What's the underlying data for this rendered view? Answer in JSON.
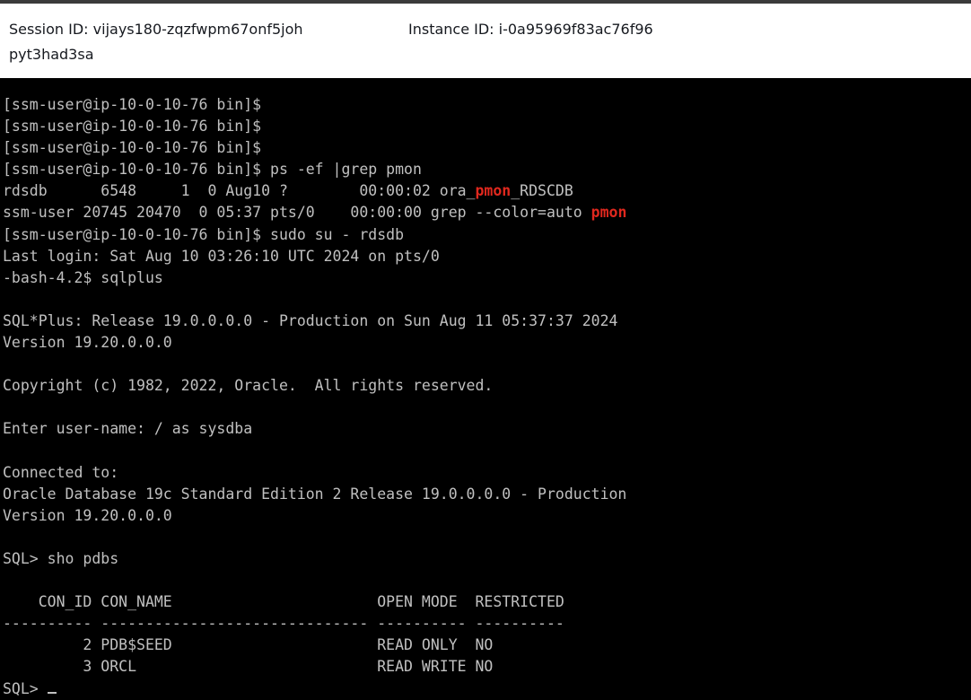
{
  "header": {
    "session_label": "Session ID: vijays180-zqzfwpm67onf5johpyt3had3sa",
    "instance_label": "Instance ID: i-0a95969f83ac76f96"
  },
  "terminal": {
    "lines": [
      "[ssm-user@ip-10-0-10-76 bin]$",
      "[ssm-user@ip-10-0-10-76 bin]$",
      "[ssm-user@ip-10-0-10-76 bin]$",
      "[ssm-user@ip-10-0-10-76 bin]$ ps -ef |grep pmon",
      "rdsdb      6548     1  0 Aug10 ?        00:00:02 ora_pmon_RDSCDB",
      "ssm-user 20745 20470  0 05:37 pts/0    00:00:00 grep --color=auto pmon",
      "[ssm-user@ip-10-0-10-76 bin]$ sudo su - rdsdb",
      "Last login: Sat Aug 10 03:26:10 UTC 2024 on pts/0",
      "-bash-4.2$ sqlplus",
      "",
      "SQL*Plus: Release 19.0.0.0.0 - Production on Sun Aug 11 05:37:37 2024",
      "Version 19.20.0.0.0",
      "",
      "Copyright (c) 1982, 2022, Oracle.  All rights reserved.",
      "",
      "Enter user-name: / as sysdba",
      "",
      "Connected to:",
      "Oracle Database 19c Standard Edition 2 Release 19.0.0.0.0 - Production",
      "Version 19.20.0.0.0",
      "",
      "SQL> sho pdbs",
      "",
      "    CON_ID CON_NAME                       OPEN MODE  RESTRICTED",
      "---------- ------------------------------ ---------- ----------",
      "         2 PDB$SEED                       READ ONLY  NO",
      "         3 ORCL                           READ WRITE NO",
      "SQL>"
    ],
    "highlight_word": "pmon",
    "highlight_lines": [
      4,
      5
    ],
    "text_color": "#c0c0c0",
    "highlight_color": "#e0281e",
    "background": "#000000"
  }
}
